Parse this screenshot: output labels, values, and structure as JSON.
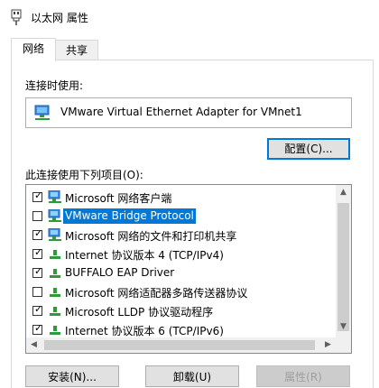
{
  "window": {
    "title": "以太网 属性"
  },
  "tabs": [
    {
      "label": "网络"
    },
    {
      "label": "共享"
    }
  ],
  "connect_using": {
    "label": "连接时使用:",
    "adapter": "VMware Virtual Ethernet Adapter for VMnet1",
    "configure_button": "配置(C)..."
  },
  "items_section": {
    "label": "此连接使用下列项目(O):",
    "items": [
      {
        "label": "Microsoft 网络客户端",
        "checked": true,
        "icon": "network-client-icon"
      },
      {
        "label": "VMware Bridge Protocol",
        "checked": false,
        "icon": "network-service-icon",
        "selected": true
      },
      {
        "label": "Microsoft 网络的文件和打印机共享",
        "checked": true,
        "icon": "network-service-icon"
      },
      {
        "label": "Internet 协议版本 4 (TCP/IPv4)",
        "checked": true,
        "icon": "protocol-icon"
      },
      {
        "label": "BUFFALO EAP Driver",
        "checked": true,
        "icon": "protocol-icon"
      },
      {
        "label": "Microsoft 网络适配器多路传送器协议",
        "checked": false,
        "icon": "protocol-icon"
      },
      {
        "label": "Microsoft LLDP 协议驱动程序",
        "checked": true,
        "icon": "protocol-icon"
      },
      {
        "label": "Internet 协议版本 6 (TCP/IPv6)",
        "checked": true,
        "icon": "protocol-icon"
      }
    ]
  },
  "buttons": {
    "install": "安装(N)...",
    "uninstall": "卸载(U)",
    "properties": "属性(R)"
  },
  "colors": {
    "selection": "#0078d7",
    "protocol_icon_green": "#2e9a3a",
    "monitor_blue": "#2a7fd4"
  }
}
